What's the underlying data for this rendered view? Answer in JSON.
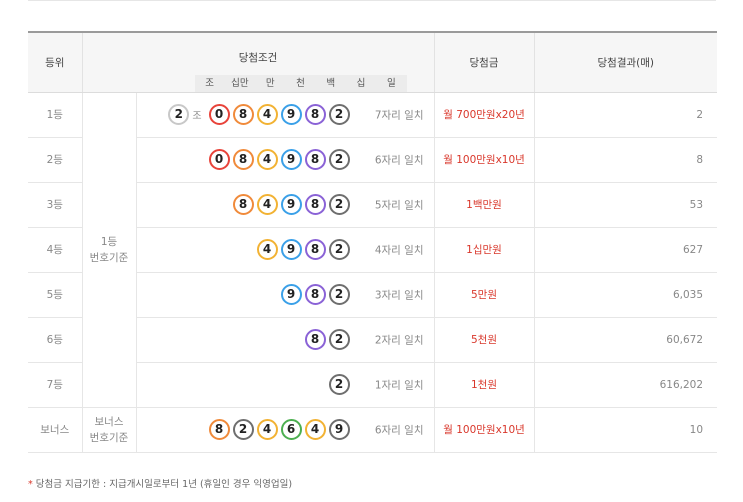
{
  "header": {
    "rank": "등위",
    "condition": "당첨조건",
    "prize": "당첨금",
    "result": "당첨결과(매)",
    "digits": [
      "조",
      "십만",
      "만",
      "천",
      "백",
      "십",
      "일"
    ]
  },
  "basis": {
    "first": "1등\n번호기준",
    "bonus": "보너스\n번호기준"
  },
  "ball_colors": {
    "0": "#e8433a",
    "2": "#6e6e6e",
    "4": "#f2b233",
    "6": "#4caf50",
    "8": "#f08a3a",
    "9": "#3aa0e8",
    "purple": "#8a62d6"
  },
  "jo_label": "조",
  "rows": [
    {
      "rank": "1등",
      "jo": "2",
      "digits": [
        "0",
        "8",
        "4",
        "9",
        "8",
        "2"
      ],
      "match": "7자리 일치",
      "prize": "월 700만원x20년",
      "count": "2"
    },
    {
      "rank": "2등",
      "digits": [
        "0",
        "8",
        "4",
        "9",
        "8",
        "2"
      ],
      "match": "6자리 일치",
      "prize": "월 100만원x10년",
      "count": "8"
    },
    {
      "rank": "3등",
      "digits": [
        "8",
        "4",
        "9",
        "8",
        "2"
      ],
      "match": "5자리 일치",
      "prize": "1백만원",
      "count": "53"
    },
    {
      "rank": "4등",
      "digits": [
        "4",
        "9",
        "8",
        "2"
      ],
      "match": "4자리 일치",
      "prize": "1십만원",
      "count": "627"
    },
    {
      "rank": "5등",
      "digits": [
        "9",
        "8",
        "2"
      ],
      "match": "3자리 일치",
      "prize": "5만원",
      "count": "6,035"
    },
    {
      "rank": "6등",
      "digits": [
        "8",
        "2"
      ],
      "match": "2자리 일치",
      "prize": "5천원",
      "count": "60,672"
    },
    {
      "rank": "7등",
      "digits": [
        "2"
      ],
      "match": "1자리 일치",
      "prize": "1천원",
      "count": "616,202"
    }
  ],
  "bonus_row": {
    "rank": "보너스",
    "digits": [
      "8",
      "2",
      "4",
      "6",
      "4",
      "9"
    ],
    "match": "6자리 일치",
    "prize": "월 100만원x10년",
    "count": "10"
  },
  "note": {
    "star": "*",
    "text": " 당첨금 지급기한 : 지급개시일로부터 1년 (휴일인 경우 익영업일)"
  }
}
